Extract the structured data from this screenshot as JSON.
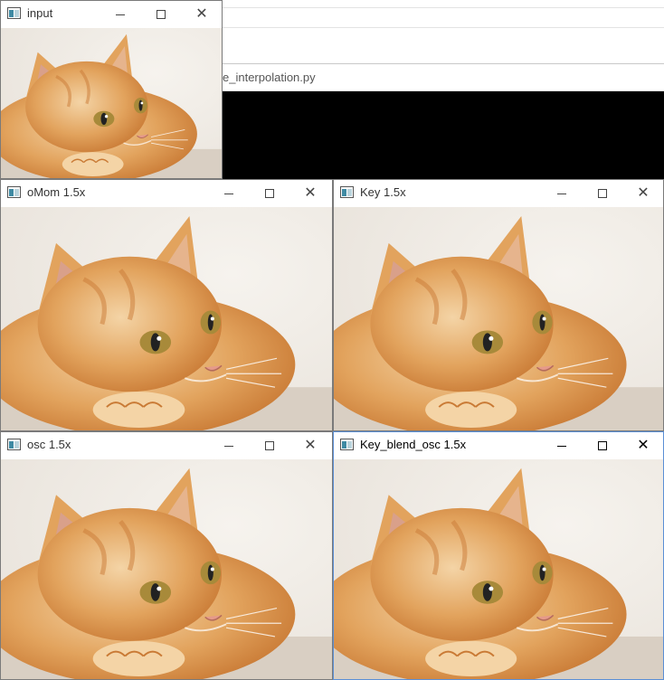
{
  "background": {
    "console_title": "e_interpolation.py"
  },
  "windows": [
    {
      "id": "input",
      "title": "input",
      "active": false
    },
    {
      "id": "omom",
      "title": "oMom 1.5x",
      "active": false
    },
    {
      "id": "key",
      "title": "Key 1.5x",
      "active": false
    },
    {
      "id": "osc",
      "title": "osc 1.5x",
      "active": false
    },
    {
      "id": "key-blend",
      "title": "Key_blend_osc 1.5x",
      "active": true
    }
  ],
  "controls": {
    "minimize_icon": "minimize-icon",
    "maximize_icon": "maximize-icon",
    "close_icon": "close-icon",
    "close_glyph": "✕"
  },
  "image": {
    "subject": "orange tabby cat lying down",
    "colors": {
      "backdrop": "#e8e2da",
      "fur": "#e2a35d",
      "fur_dark": "#c97a35",
      "fur_light": "#f4d4a6",
      "eye": "#a88a3a",
      "floor": "#d9cfc3"
    }
  }
}
